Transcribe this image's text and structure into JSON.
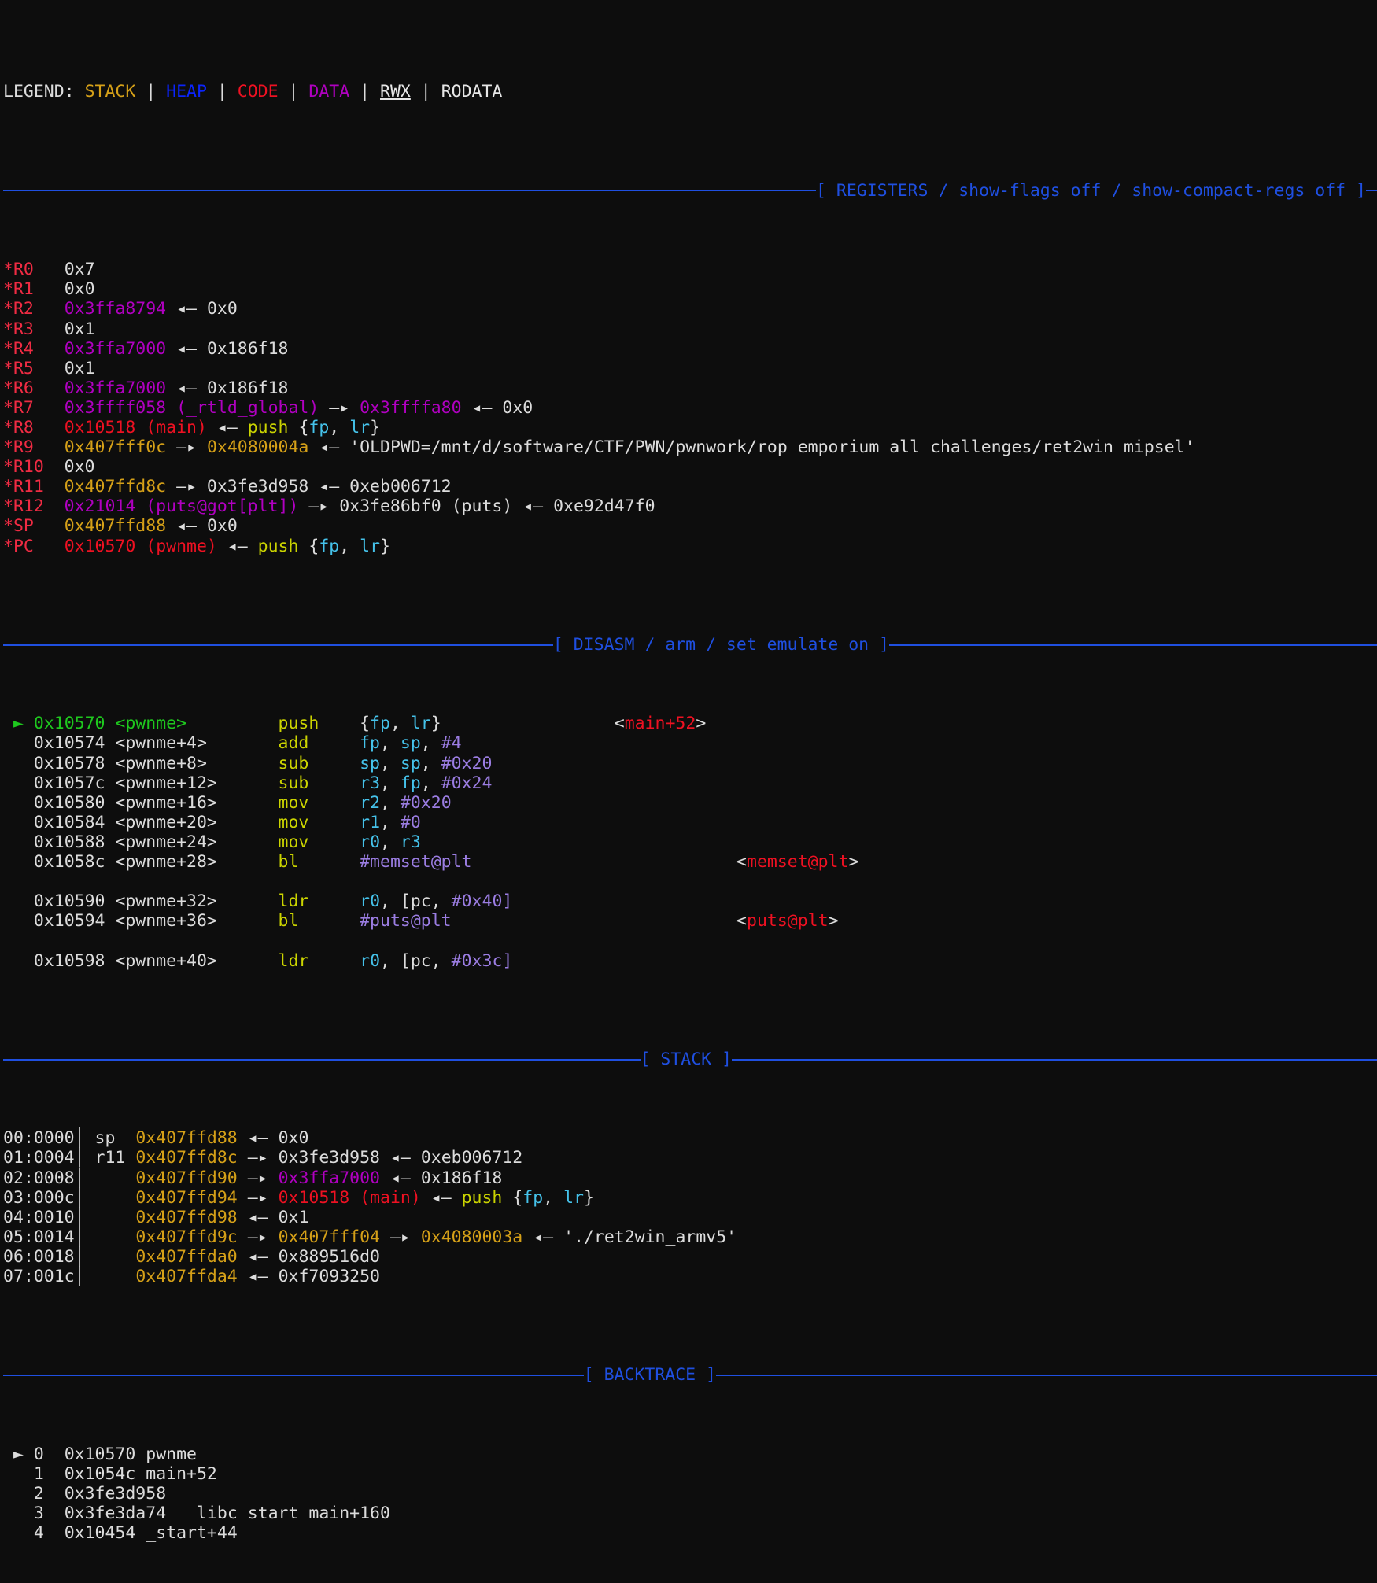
{
  "terminal": {
    "app": "pwndbg",
    "background": "#0d0d0d",
    "colors": {
      "stack": "#d5a018",
      "heap": "#0b24fb",
      "code": "#ee1122",
      "data": "#b000c0",
      "rodata": "#e6e6e6",
      "banner": "#1f4fe0",
      "register_name": "#ef2b43",
      "mnemonic": "#cbd400",
      "register_operand": "#45c2ea",
      "immediate": "#9b7de2",
      "current_instruction": "#1ec81e"
    }
  },
  "legend": {
    "label": "LEGEND:",
    "items": [
      {
        "text": "STACK",
        "color_role": "stack"
      },
      {
        "text": "HEAP",
        "color_role": "heap"
      },
      {
        "text": "CODE",
        "color_role": "code"
      },
      {
        "text": "DATA",
        "color_role": "data"
      },
      {
        "text": "RWX",
        "color_role": "rwx"
      },
      {
        "text": "RODATA",
        "color_role": "rodata"
      }
    ],
    "separator": "|"
  },
  "sections": {
    "registers": {
      "title": "[ REGISTERS / show-flags off / show-compact-regs off ]"
    },
    "disasm": {
      "title": "[ DISASM / arm / set emulate on ]"
    },
    "stack": {
      "title": "[ STACK ]"
    },
    "backtrace": {
      "title": "[ BACKTRACE ]"
    }
  },
  "registers": [
    {
      "name": "*R0",
      "value": "0x7"
    },
    {
      "name": "*R1",
      "value": "0x0"
    },
    {
      "name": "*R2",
      "value": "0x3ffa8794",
      "arrow": "<-",
      "chain": "0x0"
    },
    {
      "name": "*R3",
      "value": "0x1"
    },
    {
      "name": "*R4",
      "value": "0x3ffa7000",
      "arrow": "<-",
      "chain": "0x186f18"
    },
    {
      "name": "*R5",
      "value": "0x1"
    },
    {
      "name": "*R6",
      "value": "0x3ffa7000",
      "arrow": "<-",
      "chain": "0x186f18"
    },
    {
      "name": "*R7",
      "value": "0x3ffff058",
      "symbol": "(_rtld_global)",
      "arrow": "->",
      "chain": "0x3ffffa80",
      "arrow2": "<-",
      "chain2": "0x0"
    },
    {
      "name": "*R8",
      "value": "0x10518",
      "symbol": "(main)",
      "arrow": "<-",
      "insn_mnemonic": "push",
      "insn_operands": "{fp, lr}"
    },
    {
      "name": "*R9",
      "value": "0x407fff0c",
      "arrow": "->",
      "chain": "0x4080004a",
      "arrow2": "<-",
      "string": "'OLDPWD=/mnt/d/software/CTF/PWN/pwnwork/rop_emporium_all_challenges/ret2win_mipsel'"
    },
    {
      "name": "*R10",
      "value": "0x0"
    },
    {
      "name": "*R11",
      "value": "0x407ffd8c",
      "arrow": "->",
      "chain": "0x3fe3d958",
      "arrow2": "<-",
      "chain2": "0xeb006712"
    },
    {
      "name": "*R12",
      "value": "0x21014",
      "symbol": "(puts@got[plt])",
      "arrow": "->",
      "chain": "0x3fe86bf0",
      "chain_symbol": "(puts)",
      "arrow2": "<-",
      "chain2": "0xe92d47f0"
    },
    {
      "name": "*SP",
      "value": "0x407ffd88",
      "arrow": "<-",
      "chain": "0x0"
    },
    {
      "name": "*PC",
      "value": "0x10570",
      "symbol": "(pwnme)",
      "arrow": "<-",
      "insn_mnemonic": "push",
      "insn_operands": "{fp, lr}"
    }
  ],
  "disasm": [
    {
      "marker": "►",
      "current": true,
      "addr": "0x10570",
      "sym": "<pwnme>",
      "mnemonic": "push",
      "operands": "{fp, lr}",
      "comment": "<main+52>"
    },
    {
      "marker": " ",
      "current": false,
      "addr": "0x10574",
      "sym": "<pwnme+4>",
      "mnemonic": "add",
      "operands": "fp, sp, #4"
    },
    {
      "marker": " ",
      "current": false,
      "addr": "0x10578",
      "sym": "<pwnme+8>",
      "mnemonic": "sub",
      "operands": "sp, sp, #0x20"
    },
    {
      "marker": " ",
      "current": false,
      "addr": "0x1057c",
      "sym": "<pwnme+12>",
      "mnemonic": "sub",
      "operands": "r3, fp, #0x24"
    },
    {
      "marker": " ",
      "current": false,
      "addr": "0x10580",
      "sym": "<pwnme+16>",
      "mnemonic": "mov",
      "operands": "r2, #0x20"
    },
    {
      "marker": " ",
      "current": false,
      "addr": "0x10584",
      "sym": "<pwnme+20>",
      "mnemonic": "mov",
      "operands": "r1, #0"
    },
    {
      "marker": " ",
      "current": false,
      "addr": "0x10588",
      "sym": "<pwnme+24>",
      "mnemonic": "mov",
      "operands": "r0, r3"
    },
    {
      "marker": " ",
      "current": false,
      "addr": "0x1058c",
      "sym": "<pwnme+28>",
      "mnemonic": "bl",
      "operands": "#memset@plt",
      "comment": "<memset@plt>"
    },
    {
      "blank": true
    },
    {
      "marker": " ",
      "current": false,
      "addr": "0x10590",
      "sym": "<pwnme+32>",
      "mnemonic": "ldr",
      "operands": "r0, [pc, #0x40]"
    },
    {
      "marker": " ",
      "current": false,
      "addr": "0x10594",
      "sym": "<pwnme+36>",
      "mnemonic": "bl",
      "operands": "#puts@plt",
      "comment": "<puts@plt>"
    },
    {
      "blank": true
    },
    {
      "marker": " ",
      "current": false,
      "addr": "0x10598",
      "sym": "<pwnme+40>",
      "mnemonic": "ldr",
      "operands": "r0, [pc, #0x3c]"
    }
  ],
  "stack": [
    {
      "index": "00:0000",
      "reg": "sp",
      "addr": "0x407ffd88",
      "arrow": "<-",
      "val": "0x0"
    },
    {
      "index": "01:0004",
      "reg": "r11",
      "addr": "0x407ffd8c",
      "arrow": "->",
      "val": "0x3fe3d958",
      "arrow2": "<-",
      "val2": "0xeb006712"
    },
    {
      "index": "02:0008",
      "reg": "",
      "addr": "0x407ffd90",
      "arrow": "->",
      "val": "0x3ffa7000",
      "val_role": "data",
      "arrow2": "<-",
      "val2": "0x186f18"
    },
    {
      "index": "03:000c",
      "reg": "",
      "addr": "0x407ffd94",
      "arrow": "->",
      "val": "0x10518",
      "val_role": "code",
      "val_symbol": "(main)",
      "arrow2": "<-",
      "insn_mnemonic": "push",
      "insn_operands": "{fp, lr}"
    },
    {
      "index": "04:0010",
      "reg": "",
      "addr": "0x407ffd98",
      "arrow": "<-",
      "val": "0x1"
    },
    {
      "index": "05:0014",
      "reg": "",
      "addr": "0x407ffd9c",
      "arrow": "->",
      "val": "0x407fff04",
      "val_role": "stack",
      "arrow2": "->",
      "val2": "0x4080003a",
      "val2_role": "stack",
      "arrow3": "<-",
      "string": "'./ret2win_armv5'"
    },
    {
      "index": "06:0018",
      "reg": "",
      "addr": "0x407ffda0",
      "arrow": "<-",
      "val": "0x889516d0"
    },
    {
      "index": "07:001c",
      "reg": "",
      "addr": "0x407ffda4",
      "arrow": "<-",
      "val": "0xf7093250"
    }
  ],
  "backtrace": [
    {
      "marker": "►",
      "index": "0",
      "addr": "0x10570",
      "sym": "pwnme"
    },
    {
      "marker": " ",
      "index": "1",
      "addr": "0x1054c",
      "sym": "main+52"
    },
    {
      "marker": " ",
      "index": "2",
      "addr": "0x3fe3d958",
      "sym": ""
    },
    {
      "marker": " ",
      "index": "3",
      "addr": "0x3fe3da74",
      "sym": "__libc_start_main+160"
    },
    {
      "marker": " ",
      "index": "4",
      "addr": "0x10454",
      "sym": "_start+44"
    }
  ]
}
